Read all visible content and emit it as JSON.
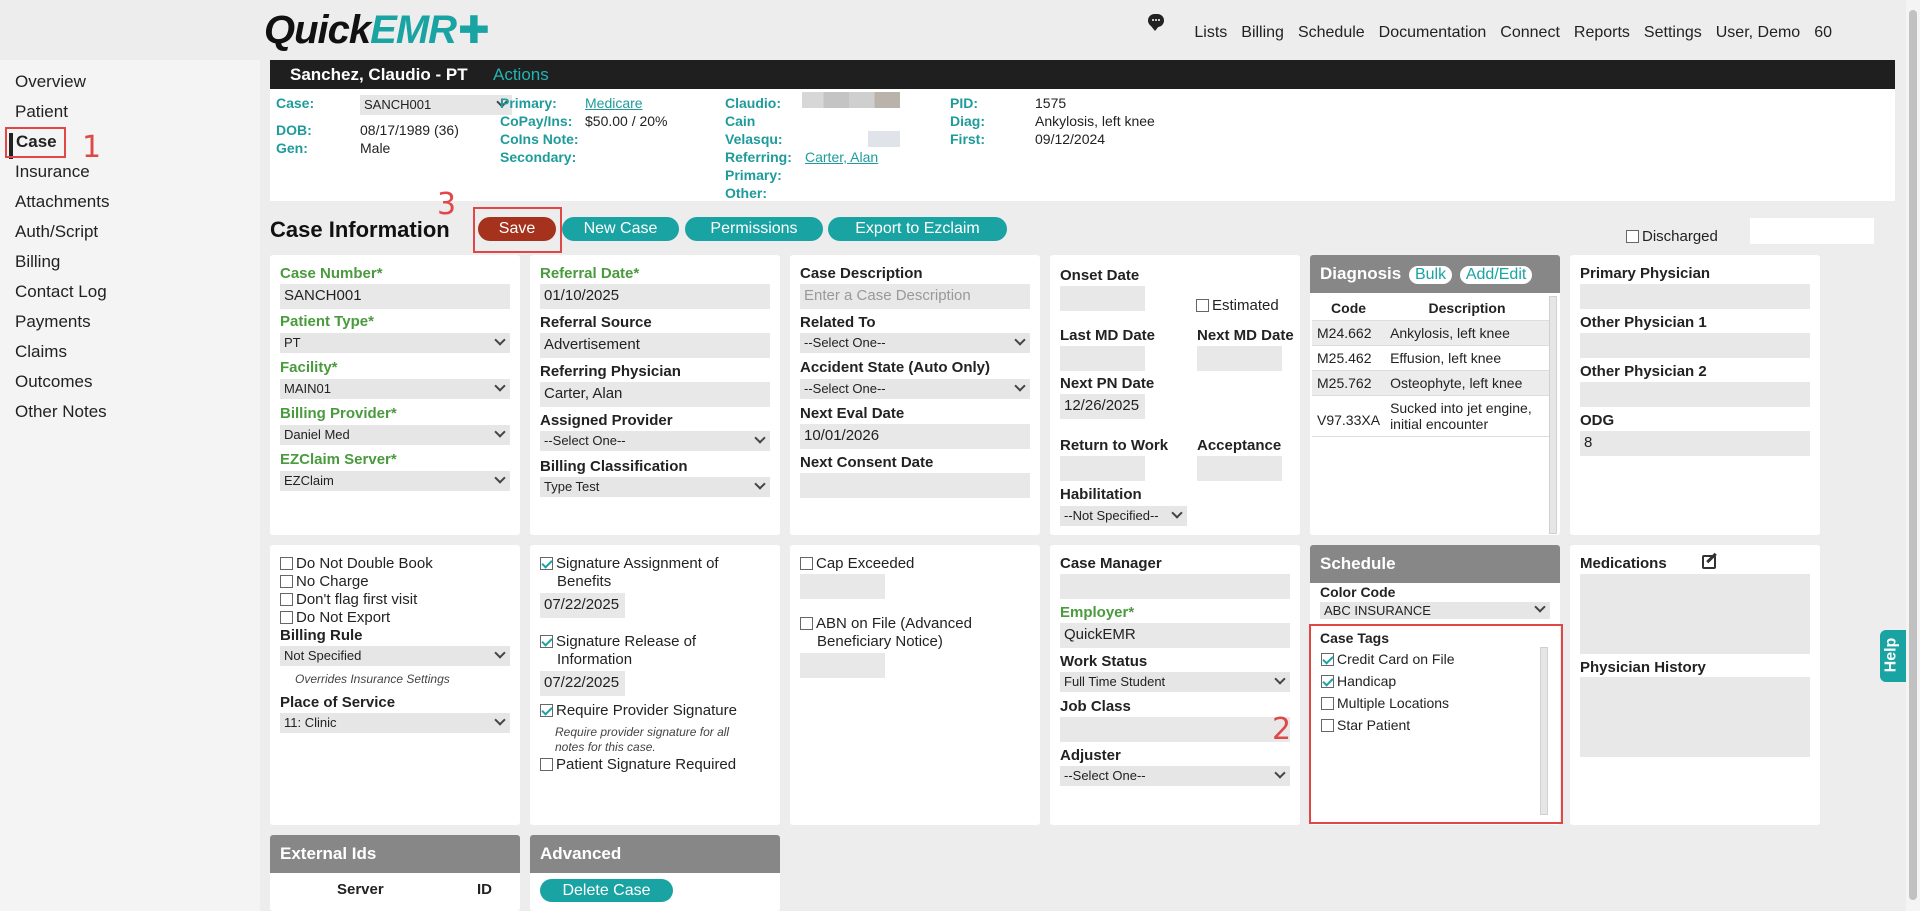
{
  "app": {
    "logo_quick": "Quick",
    "logo_emr": "EMR",
    "top_nav": [
      "Lists",
      "Billing",
      "Schedule",
      "Documentation",
      "Connect",
      "Reports",
      "Settings",
      "User, Demo",
      "60"
    ]
  },
  "left_nav": [
    "Overview",
    "Patient",
    "Case",
    "Insurance",
    "Attachments",
    "Auth/Script",
    "Billing",
    "Contact Log",
    "Payments",
    "Claims",
    "Outcomes",
    "Other Notes"
  ],
  "annotations": {
    "n1": "1",
    "n2": "2",
    "n3": "3"
  },
  "patient": {
    "name": "Sanchez, Claudio - PT",
    "actions": "Actions",
    "case_label": "Case:",
    "case_value": "SANCH001",
    "dob_label": "DOB:",
    "dob_value": "08/17/1989 (36)",
    "gen_label": "Gen:",
    "gen_value": "Male",
    "primary_label": "Primary:",
    "primary_value": "Medicare",
    "copay_label": "CoPay/Ins:",
    "copay_value": "$50.00 / 20%",
    "coins_label": "CoIns Note:",
    "secondary_label": "Secondary:",
    "claudio_label": "Claudio:",
    "cain_label": "Cain",
    "velasqu_label": "Velasqu:",
    "referring_label": "Referring:",
    "referring_value": "Carter, Alan",
    "primary2_label": "Primary:",
    "other_label": "Other:",
    "pid_label": "PID:",
    "pid_value": "1575",
    "diag_label": "Diag:",
    "diag_value": "Ankylosis, left knee",
    "first_label": "First:",
    "first_value": "09/12/2024"
  },
  "case_info": {
    "title": "Case Information",
    "buttons": {
      "save": "Save",
      "new_case": "New Case",
      "permissions": "Permissions",
      "export": "Export to Ezclaim"
    },
    "discharged": "Discharged"
  },
  "card1": {
    "case_number_label": "Case Number*",
    "case_number": "SANCH001",
    "patient_type_label": "Patient Type*",
    "patient_type": "PT",
    "facility_label": "Facility*",
    "facility": "MAIN01",
    "billing_provider_label": "Billing Provider*",
    "billing_provider": "Daniel Med",
    "ezclaim_label": "EZClaim Server*",
    "ezclaim": "EZClaim"
  },
  "card2": {
    "referral_date_label": "Referral Date*",
    "referral_date": "01/10/2025",
    "referral_source_label": "Referral Source",
    "referral_source": "Advertisement",
    "referring_physician_label": "Referring Physician",
    "referring_physician": "Carter, Alan",
    "assigned_provider_label": "Assigned Provider",
    "assigned_provider": "--Select One--",
    "billing_class_label": "Billing Classification",
    "billing_class": "Type Test"
  },
  "card3": {
    "case_desc_label": "Case Description",
    "case_desc_placeholder": "Enter a Case Description",
    "related_to_label": "Related To",
    "related_to": "--Select One--",
    "accident_state_label": "Accident State (Auto Only)",
    "accident_state": "--Select One--",
    "next_eval_label": "Next Eval Date",
    "next_eval": "10/01/2026",
    "next_consent_label": "Next Consent Date"
  },
  "card4": {
    "onset_label": "Onset Date",
    "estimated": "Estimated",
    "last_md_label": "Last MD Date",
    "next_md_label": "Next MD Date",
    "next_pn_label": "Next PN Date",
    "next_pn": "12/26/2025",
    "return_work_label": "Return to Work",
    "acceptance_label": "Acceptance",
    "habilitation_label": "Habilitation",
    "habilitation": "--Not Specified--"
  },
  "diagnosis": {
    "title": "Diagnosis",
    "bulk": "Bulk",
    "add_edit": "Add/Edit",
    "col_code": "Code",
    "col_desc": "Description",
    "rows": [
      {
        "code": "M24.662",
        "desc": "Ankylosis, left knee"
      },
      {
        "code": "M25.462",
        "desc": "Effusion, left knee"
      },
      {
        "code": "M25.762",
        "desc": "Osteophyte, left knee"
      },
      {
        "code": "V97.33XA",
        "desc": "Sucked into jet engine, initial encounter"
      }
    ]
  },
  "physicians": {
    "primary_label": "Primary Physician",
    "other1_label": "Other Physician 1",
    "other2_label": "Other Physician 2",
    "odg_label": "ODG",
    "odg": "8"
  },
  "card5": {
    "do_not_double_book": "Do Not Double Book",
    "no_charge": "No Charge",
    "dont_flag": "Don't flag first visit",
    "do_not_export": "Do Not Export",
    "billing_rule_label": "Billing Rule",
    "billing_rule": "Not Specified",
    "overrides_note": "Overrides Insurance Settings",
    "place_of_service_label": "Place of Service",
    "place_of_service": "11: Clinic"
  },
  "card6": {
    "sig_assign_l1": "Signature Assignment of",
    "sig_assign_l2": "Benefits",
    "sig_assign_date": "07/22/2025",
    "sig_release_l1": "Signature Release of",
    "sig_release_l2": "Information",
    "sig_release_date": "07/22/2025",
    "require_provider_sig": "Require Provider Signature",
    "require_note_l1": "Require provider signature for all",
    "require_note_l2": "notes for this case.",
    "patient_sig": "Patient Signature Required"
  },
  "card7": {
    "cap_exceeded": "Cap Exceeded",
    "abn_l1": "ABN on File (Advanced",
    "abn_l2": "Beneficiary Notice)"
  },
  "card8": {
    "case_manager_label": "Case Manager",
    "employer_label": "Employer*",
    "employer": "QuickEMR",
    "work_status_label": "Work Status",
    "work_status": "Full Time Student",
    "job_class_label": "Job Class",
    "adjuster_label": "Adjuster",
    "adjuster": "--Select One--"
  },
  "schedule": {
    "title": "Schedule",
    "color_code_label": "Color Code",
    "color_code": "ABC INSURANCE",
    "case_tags_label": "Case Tags",
    "tags": [
      {
        "label": "Credit Card on File",
        "checked": true
      },
      {
        "label": "Handicap",
        "checked": true
      },
      {
        "label": "Multiple Locations",
        "checked": false
      },
      {
        "label": "Star Patient",
        "checked": false
      }
    ]
  },
  "medications": {
    "label": "Medications",
    "history_label": "Physician History"
  },
  "external_ids": {
    "title": "External Ids",
    "col_server": "Server",
    "col_id": "ID"
  },
  "advanced": {
    "title": "Advanced",
    "delete_case": "Delete Case"
  },
  "help": "Help"
}
